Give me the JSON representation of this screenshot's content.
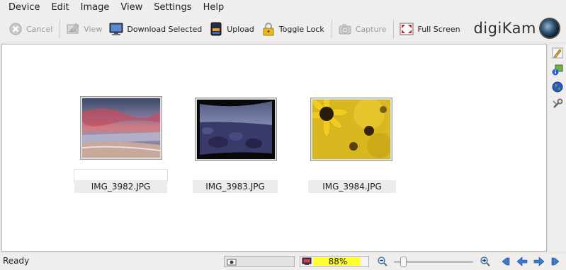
{
  "menu": {
    "items": [
      {
        "label": "Device"
      },
      {
        "label": "Edit"
      },
      {
        "label": "Image"
      },
      {
        "label": "View"
      },
      {
        "label": "Settings"
      },
      {
        "label": "Help"
      }
    ]
  },
  "toolbar": {
    "cancel_label": "Cancel",
    "view_label": "View",
    "download_label": "Download Selected",
    "upload_label": "Upload",
    "toggle_lock_label": "Toggle Lock",
    "capture_label": "Capture",
    "fullscreen_label": "Full Screen"
  },
  "brand": {
    "name": "digiKam"
  },
  "thumbnails": [
    {
      "filename": "IMG_3982.JPG",
      "icon": "sunset-beach-photo"
    },
    {
      "filename": "IMG_3983.JPG",
      "icon": "rocky-shore-photo"
    },
    {
      "filename": "IMG_3984.JPG",
      "icon": "sunflowers-photo"
    }
  ],
  "sidebar": {
    "tabs": [
      {
        "icon": "edit-pencil-icon"
      },
      {
        "icon": "image-info-icon"
      },
      {
        "icon": "globe-icon"
      },
      {
        "icon": "tools-icon"
      }
    ]
  },
  "status": {
    "text": "Ready",
    "progress_percent": "88%",
    "progress_value": 0.88
  },
  "colors": {
    "progress_fill": "#ffff33",
    "selection_bg": "#ececec"
  }
}
